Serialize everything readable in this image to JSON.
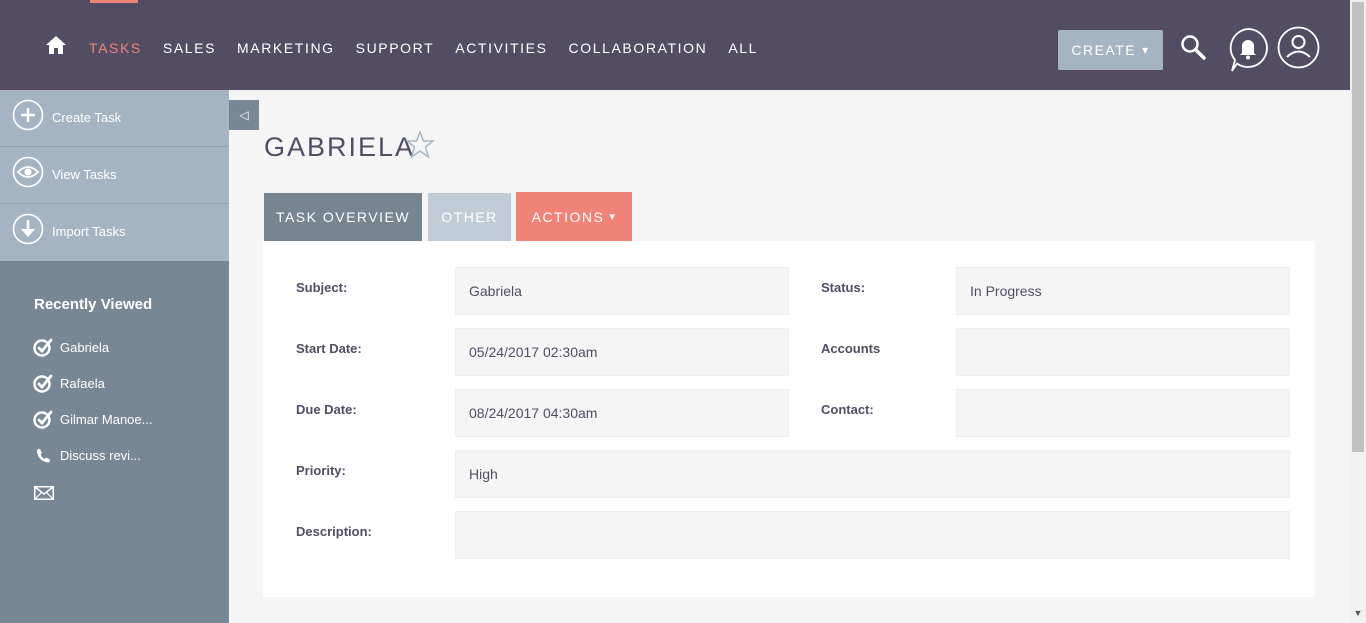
{
  "nav": {
    "items": [
      "TASKS",
      "SALES",
      "MARKETING",
      "SUPPORT",
      "ACTIVITIES",
      "COLLABORATION",
      "ALL"
    ],
    "active": "TASKS",
    "create_label": "CREATE",
    "create_caret": "▾"
  },
  "sidebar": {
    "actions": [
      {
        "label": "Create Task",
        "icon": "plus-circle-icon"
      },
      {
        "label": "View Tasks",
        "icon": "eye-circle-icon"
      },
      {
        "label": "Import Tasks",
        "icon": "download-circle-icon"
      }
    ],
    "recent_title": "Recently Viewed",
    "recent_items": [
      {
        "label": "Gabriela",
        "icon": "task-icon"
      },
      {
        "label": "Rafaela",
        "icon": "task-icon"
      },
      {
        "label": "Gilmar Manoe...",
        "icon": "task-icon"
      },
      {
        "label": "Discuss revi...",
        "icon": "phone-icon"
      }
    ],
    "collapse_glyph": "◁"
  },
  "record": {
    "title": "GABRIELA"
  },
  "tabs": {
    "overview": "TASK OVERVIEW",
    "other": "OTHER",
    "actions": "ACTIONS",
    "actions_caret": "▾"
  },
  "fields": {
    "subject_label": "Subject:",
    "subject_value": "Gabriela",
    "status_label": "Status:",
    "status_value": "In Progress",
    "start_label": "Start Date:",
    "start_value": "05/24/2017 02:30am",
    "accounts_label": "Accounts",
    "accounts_value": "",
    "due_label": "Due Date:",
    "due_value": "08/24/2017 04:30am",
    "contact_label": "Contact:",
    "contact_value": "",
    "priority_label": "Priority:",
    "priority_value": "High",
    "description_label": "Description:",
    "description_value": ""
  },
  "colors": {
    "header": "#534d64",
    "accent": "#f08377",
    "sidebar": "#788795",
    "sidebar_actions": "#a5b4c2"
  }
}
